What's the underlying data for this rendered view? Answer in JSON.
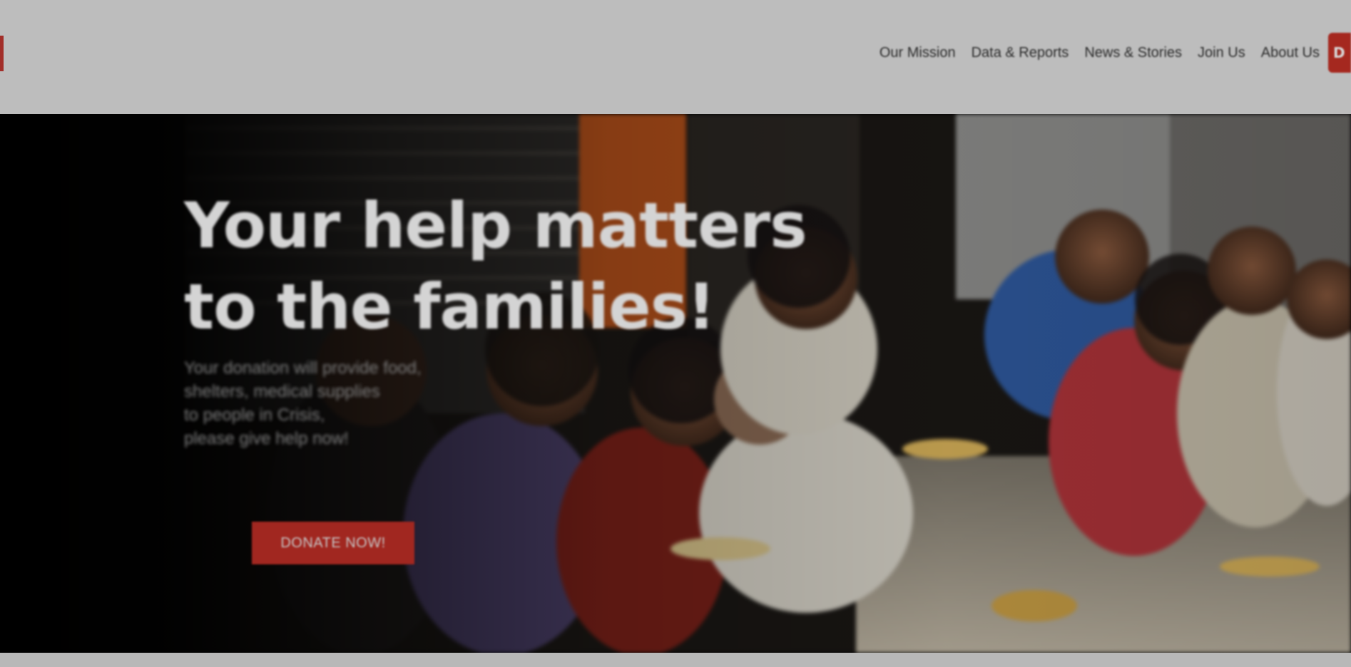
{
  "header": {
    "nav": [
      "Our Mission",
      "Data & Reports",
      "News & Stories",
      "Join Us",
      "About Us"
    ],
    "donate_tab_label": "D"
  },
  "hero": {
    "title_lines": [
      "Your help matters",
      "to the families!"
    ],
    "subtitle_lines": [
      "Your donation will provide food,",
      "shelters, medical supplies",
      "to people in Crisis,",
      "please give help now!"
    ],
    "cta_label": "DONATE NOW!",
    "photo_subject": "people-sharing-food-on-street"
  },
  "colors": {
    "accent": "#a5281f",
    "header_bg": "#bdbdbd",
    "title_text": "#d4d4d4",
    "subtitle_text": "#7d7d7d"
  }
}
